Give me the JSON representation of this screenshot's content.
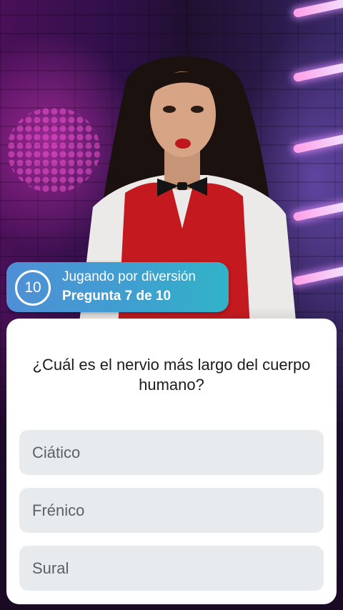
{
  "status": {
    "timer": "10",
    "mode": "Jugando por diversión",
    "progress": "Pregunta 7 de 10"
  },
  "question": {
    "text": "¿Cuál es el nervio más largo del cuerpo humano?",
    "options": [
      "Ciático",
      "Frénico",
      "Sural"
    ]
  },
  "colors": {
    "pill_gradient_start": "#4f8fd6",
    "pill_gradient_end": "#31b3c7",
    "option_bg": "#e8ebee",
    "card_bg": "#ffffff"
  }
}
